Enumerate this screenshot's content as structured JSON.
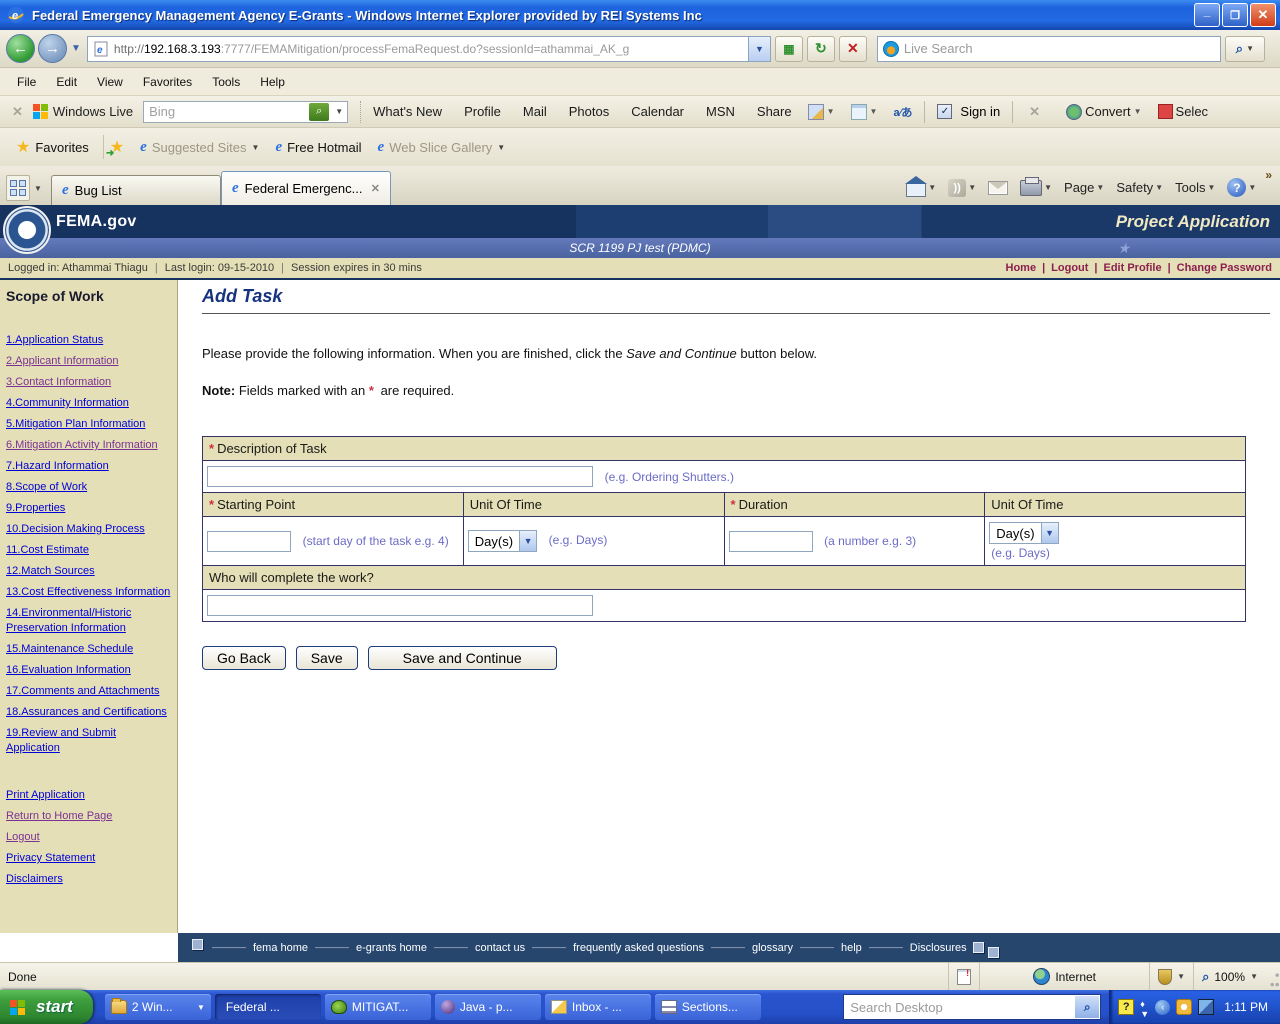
{
  "window": {
    "title": "Federal Emergency Management Agency E-Grants - Windows Internet Explorer provided by REI Systems Inc"
  },
  "browser": {
    "address": {
      "url_scheme": "http://",
      "url_host": "192.168.3.193",
      "url_rest": ":7777/FEMAMitigation/processFemaRequest.do?sessionId=athammai_AK_g"
    },
    "live_search_placeholder": "Live Search",
    "menu_items": [
      "File",
      "Edit",
      "View",
      "Favorites",
      "Tools",
      "Help"
    ],
    "live_toolbar": {
      "brand_label": "Windows Live",
      "search_placeholder": "Bing",
      "links": [
        "What's New",
        "Profile",
        "Mail",
        "Photos",
        "Calendar",
        "MSN",
        "Share"
      ],
      "sign_in_label": "Sign in",
      "convert_label": "Convert",
      "select_label": "Selec"
    },
    "favorites_bar": {
      "favorites_label": "Favorites",
      "items": [
        {
          "label": "Suggested Sites",
          "dropdown": true,
          "muted": true
        },
        {
          "label": "Free Hotmail",
          "dropdown": false,
          "muted": false
        },
        {
          "label": "Web Slice Gallery",
          "dropdown": true,
          "muted": true
        }
      ]
    },
    "tabs": [
      {
        "label": "Bug List",
        "active": false,
        "closable": false
      },
      {
        "label": "Federal Emergenc...",
        "active": true,
        "closable": true
      }
    ],
    "command_bar": {
      "page_label": "Page",
      "safety_label": "Safety",
      "tools_label": "Tools"
    }
  },
  "site": {
    "brand": "FEMA.gov",
    "banner_title": "Project Application",
    "app_subtitle": "SCR 1199 PJ test (PDMC)",
    "login_info": {
      "logged_in": "Logged in: Athammai Thiagu",
      "last_login": "Last login: 09-15-2010",
      "session": "Session expires in 30 mins"
    },
    "account_links": [
      "Home",
      "Logout",
      "Edit Profile",
      "Change Password"
    ]
  },
  "sidebar": {
    "heading": "Scope of Work",
    "items": [
      {
        "label": "1.Application Status",
        "state": "fresh"
      },
      {
        "label": "2.Applicant Information",
        "state": "visited"
      },
      {
        "label": "3.Contact Information",
        "state": "visited"
      },
      {
        "label": "4.Community Information",
        "state": "fresh"
      },
      {
        "label": "5.Mitigation Plan Information",
        "state": "fresh"
      },
      {
        "label": "6.Mitigation Activity Information",
        "state": "visited"
      },
      {
        "label": "7.Hazard Information",
        "state": "fresh"
      },
      {
        "label": "8.Scope of Work",
        "state": "fresh"
      },
      {
        "label": "9.Properties",
        "state": "fresh"
      },
      {
        "label": "10.Decision Making Process",
        "state": "fresh"
      },
      {
        "label": "11.Cost Estimate",
        "state": "fresh"
      },
      {
        "label": "12.Match Sources",
        "state": "fresh"
      },
      {
        "label": "13.Cost Effectiveness Information",
        "state": "fresh"
      },
      {
        "label": "14.Environmental/Historic Preservation Information",
        "state": "fresh"
      },
      {
        "label": "15.Maintenance Schedule",
        "state": "fresh"
      },
      {
        "label": "16.Evaluation Information",
        "state": "fresh"
      },
      {
        "label": "17.Comments and Attachments",
        "state": "fresh"
      },
      {
        "label": "18.Assurances and Certifications",
        "state": "fresh"
      },
      {
        "label": "19.Review and Submit Application",
        "state": "fresh"
      }
    ],
    "utility_links": [
      {
        "label": "Print Application",
        "state": "fresh"
      },
      {
        "label": "Return to Home Page",
        "state": "visited"
      },
      {
        "label": "Logout",
        "state": "visited"
      },
      {
        "label": "Privacy Statement",
        "state": "fresh"
      },
      {
        "label": "Disclaimers",
        "state": "fresh"
      }
    ]
  },
  "main": {
    "page_title": "Add Task",
    "intro": {
      "part1": "Please provide the following information. When you are finished, click the ",
      "emph": "Save and Continue",
      "part2": " button below."
    },
    "note": {
      "label": "Note:",
      "part1": " Fields marked with an ",
      "star": "*",
      "part2": " are required."
    },
    "form": {
      "required_marker": "*",
      "description": {
        "label": "Description of Task",
        "hint": "(e.g. Ordering Shutters.)"
      },
      "starting_point": {
        "label": "Starting Point",
        "hint": "(start day of the task e.g. 4)"
      },
      "unit_of_time_1": {
        "label": "Unit Of Time",
        "value": "Day(s)",
        "hint": "(e.g. Days)"
      },
      "duration": {
        "label": "Duration",
        "hint": "(a number e.g. 3)"
      },
      "unit_of_time_2": {
        "label": "Unit Of Time",
        "value": "Day(s)",
        "hint": "(e.g. Days)"
      },
      "who": {
        "label": "Who will complete the work?"
      }
    },
    "buttons": {
      "go_back": "Go Back",
      "save": "Save",
      "save_continue": "Save and Continue"
    }
  },
  "footer": {
    "links": [
      {
        "label": "fema home"
      },
      {
        "label": "e-grants home"
      },
      {
        "label": "contact us"
      },
      {
        "label": "frequently asked questions"
      },
      {
        "label": "glossary"
      },
      {
        "label": "help"
      },
      {
        "label": "Disclosures"
      }
    ]
  },
  "status_bar": {
    "text": "Done",
    "zone": "Internet",
    "zoom_level": "100%"
  },
  "taskbar": {
    "start_label": "start",
    "tasks": [
      {
        "label": "2 Win...",
        "icon": "icon-folder",
        "grouped": true,
        "active": false
      },
      {
        "label": "Federal ...",
        "icon": "icon-ie",
        "grouped": false,
        "active": true
      },
      {
        "label": "MITIGAT...",
        "icon": "icon-toad",
        "grouped": false,
        "active": false
      },
      {
        "label": "Java - p...",
        "icon": "icon-eclipse",
        "grouped": false,
        "active": false
      },
      {
        "label": "Inbox - ...",
        "icon": "icon-outlook",
        "grouped": false,
        "active": false
      },
      {
        "label": "Sections...",
        "icon": "icon-word",
        "grouped": false,
        "active": false
      }
    ],
    "search_placeholder": "Search Desktop",
    "clock": "1:11 PM"
  }
}
